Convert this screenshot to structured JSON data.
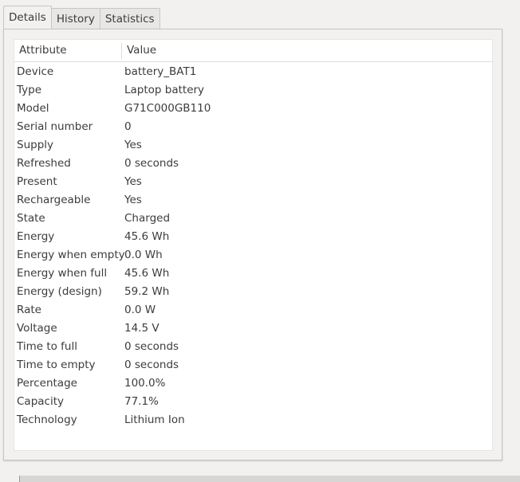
{
  "tabs": [
    {
      "label": "Details"
    },
    {
      "label": "History"
    },
    {
      "label": "Statistics"
    }
  ],
  "table": {
    "columns": {
      "attribute": "Attribute",
      "value": "Value"
    },
    "rows": [
      {
        "attribute": "Device",
        "value": "battery_BAT1"
      },
      {
        "attribute": "Type",
        "value": "Laptop battery"
      },
      {
        "attribute": "Model",
        "value": "G71C000GB110"
      },
      {
        "attribute": "Serial number",
        "value": "0"
      },
      {
        "attribute": "Supply",
        "value": "Yes"
      },
      {
        "attribute": "Refreshed",
        "value": "0 seconds"
      },
      {
        "attribute": "Present",
        "value": "Yes"
      },
      {
        "attribute": "Rechargeable",
        "value": "Yes"
      },
      {
        "attribute": "State",
        "value": "Charged"
      },
      {
        "attribute": "Energy",
        "value": "45.6 Wh"
      },
      {
        "attribute": "Energy when empty",
        "value": "0.0 Wh"
      },
      {
        "attribute": "Energy when full",
        "value": "45.6 Wh"
      },
      {
        "attribute": "Energy (design)",
        "value": "59.2 Wh"
      },
      {
        "attribute": "Rate",
        "value": "0.0 W"
      },
      {
        "attribute": "Voltage",
        "value": "14.5 V"
      },
      {
        "attribute": "Time to full",
        "value": "0 seconds"
      },
      {
        "attribute": "Time to empty",
        "value": "0 seconds"
      },
      {
        "attribute": "Percentage",
        "value": "100.0%"
      },
      {
        "attribute": "Capacity",
        "value": "77.1%"
      },
      {
        "attribute": "Technology",
        "value": "Lithium Ion"
      }
    ]
  }
}
